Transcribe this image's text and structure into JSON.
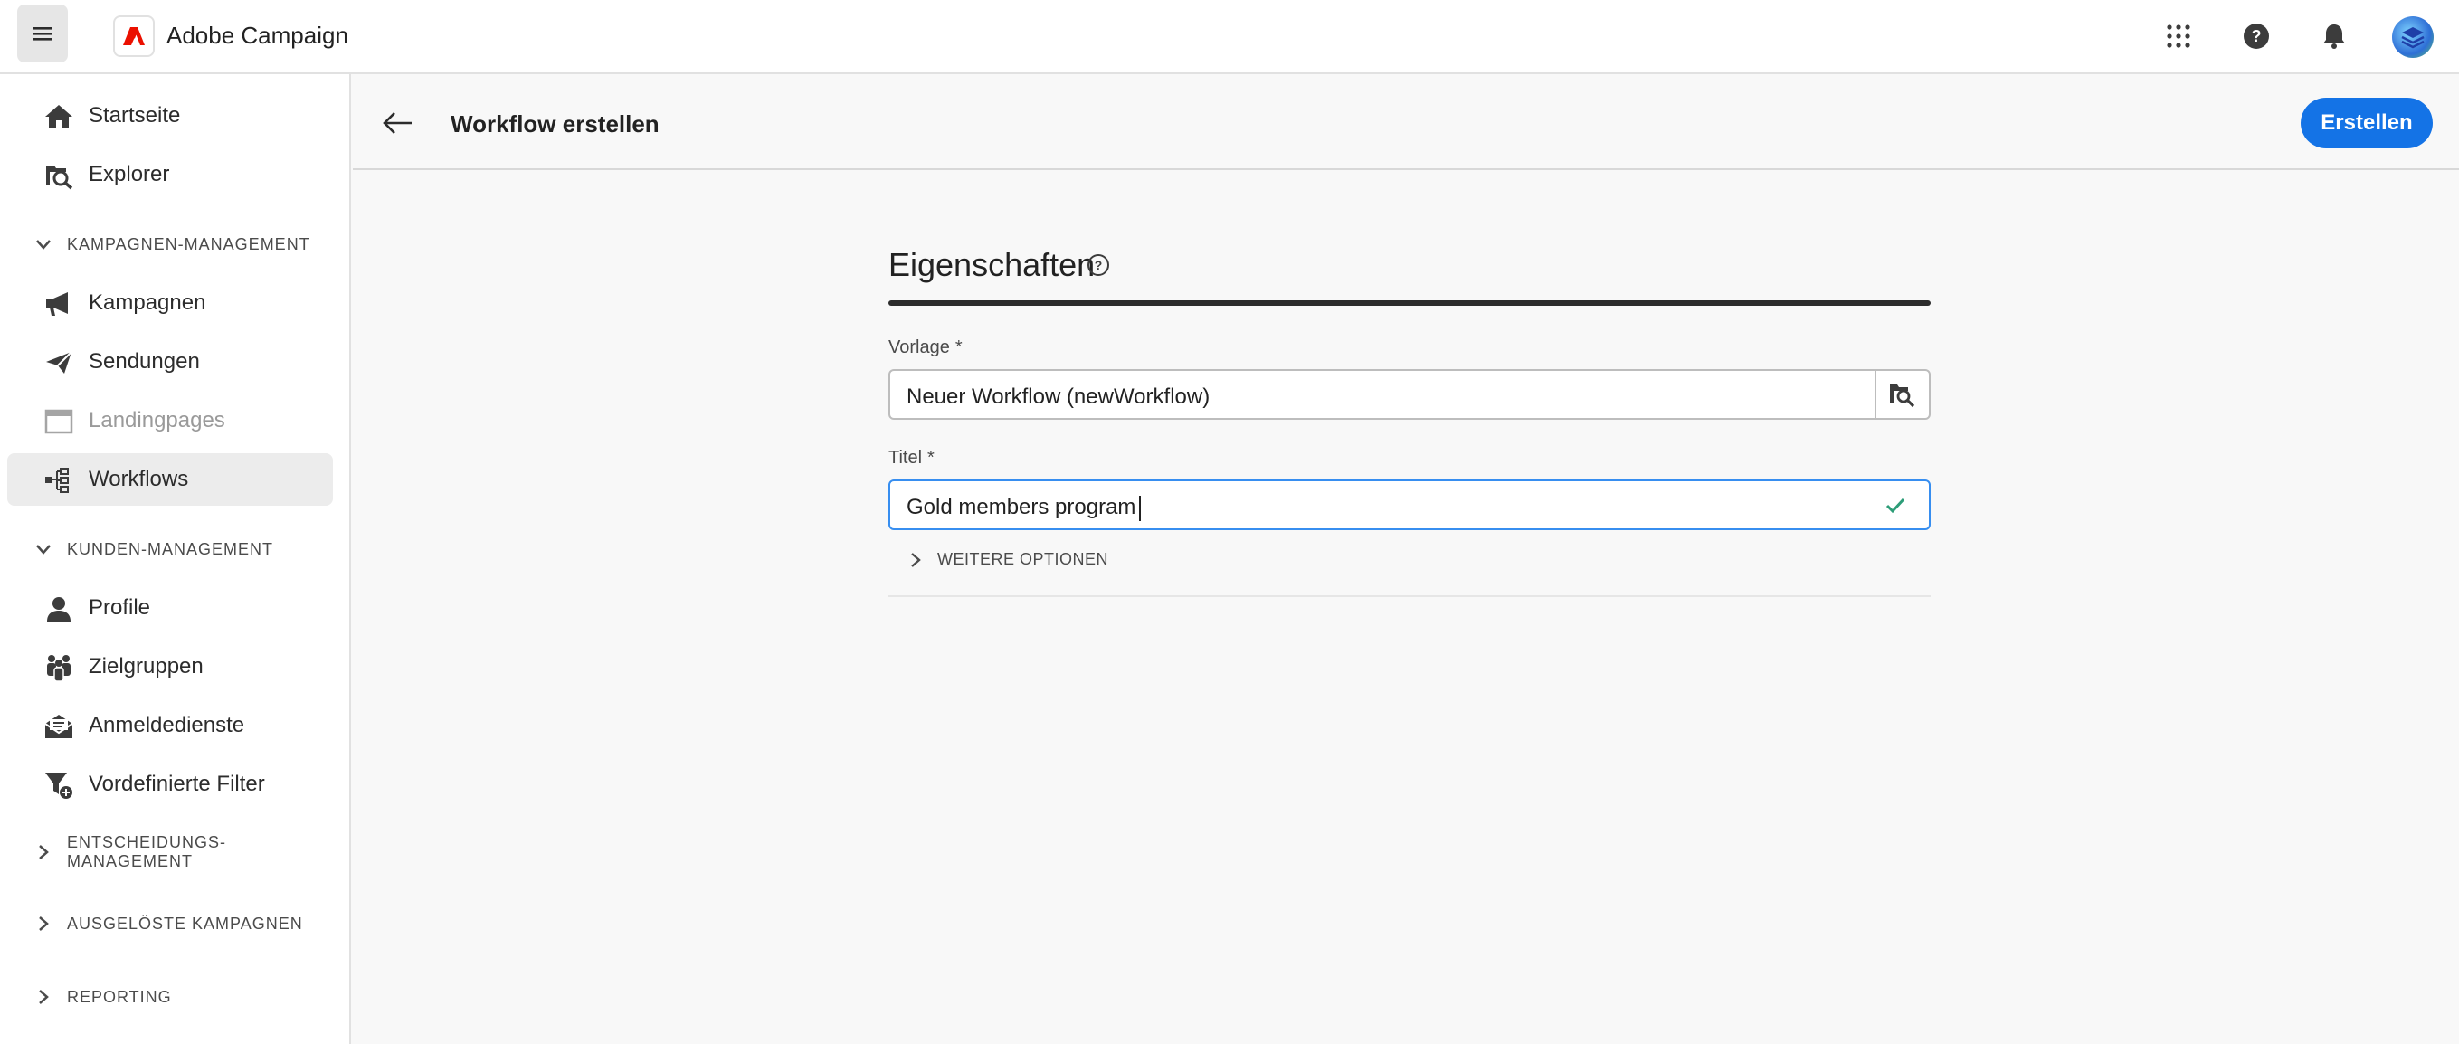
{
  "app": {
    "name": "Adobe Campaign"
  },
  "topbar": {
    "menu_icon": "hamburger-icon",
    "apps_icon": "apps-grid-icon",
    "help_icon": "help-icon",
    "notifications_icon": "bell-icon"
  },
  "sidebar": {
    "items": [
      {
        "label": "Startseite",
        "icon": "home-icon"
      },
      {
        "label": "Explorer",
        "icon": "folder-search-icon"
      },
      {
        "label": "Kampagnen",
        "icon": "megaphone-icon"
      },
      {
        "label": "Sendungen",
        "icon": "send-icon"
      },
      {
        "label": "Landingpages",
        "icon": "webpage-icon",
        "disabled": true
      },
      {
        "label": "Workflows",
        "icon": "workflow-icon",
        "active": true
      },
      {
        "label": "Profile",
        "icon": "user-icon"
      },
      {
        "label": "Zielgruppen",
        "icon": "users-icon"
      },
      {
        "label": "Anmeldedienste",
        "icon": "envelope-icon"
      },
      {
        "label": "Vordefinierte Filter",
        "icon": "filter-add-icon"
      }
    ],
    "sections": [
      {
        "label": "KAMPAGNEN-MANAGEMENT",
        "expanded": true
      },
      {
        "label": "KUNDEN-MANAGEMENT",
        "expanded": true
      },
      {
        "label": "ENTSCHEIDUNGS- MANAGEMENT",
        "expanded": false
      },
      {
        "label": "AUSGELÖSTE KAMPAGNEN",
        "expanded": false
      },
      {
        "label": "REPORTING",
        "expanded": false
      }
    ]
  },
  "header": {
    "title": "Workflow erstellen",
    "create_label": "Erstellen"
  },
  "form": {
    "section_title": "Eigenschaften",
    "template": {
      "label": "Vorlage",
      "required_mark": "*",
      "value": "Neuer Workflow (newWorkflow)"
    },
    "title": {
      "label": "Titel",
      "required_mark": "*",
      "value": "Gold members program"
    },
    "more_options_label": "WEITERE OPTIONEN"
  },
  "colors": {
    "accent": "#1473e6",
    "valid": "#2d9d78",
    "brand": "#eb1000"
  }
}
